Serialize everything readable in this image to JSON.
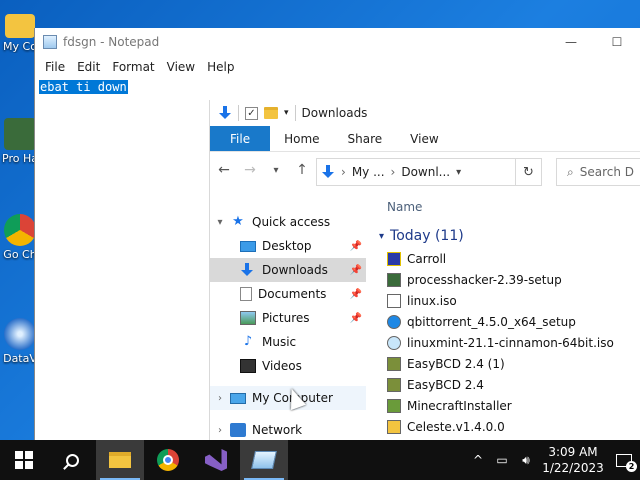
{
  "desktop": {
    "icons": [
      {
        "label": "My Co",
        "icon": "folder-icon"
      },
      {
        "label": "Pro Ha",
        "icon": "process-hacker-icon"
      },
      {
        "label": "Go Ch",
        "icon": "chrome-icon"
      },
      {
        "label": "DataV",
        "icon": "datav-icon"
      }
    ]
  },
  "notepad": {
    "title": "fdsgn - Notepad",
    "menu": [
      "File",
      "Edit",
      "Format",
      "View",
      "Help"
    ],
    "selected_text": "ebat ti down",
    "window_buttons": {
      "minimize": "—",
      "maximize": "☐"
    }
  },
  "explorer": {
    "title": "Downloads",
    "ribbon_tabs": [
      "File",
      "Home",
      "Share",
      "View"
    ],
    "address": {
      "crumb1": "My ...",
      "crumb2": "Downl...",
      "separator": "›"
    },
    "search_placeholder": "Search D",
    "nav": {
      "quick_access": "Quick access",
      "items": [
        {
          "label": "Desktop",
          "pinned": true
        },
        {
          "label": "Downloads",
          "pinned": true,
          "selected": true
        },
        {
          "label": "Documents",
          "pinned": true
        },
        {
          "label": "Pictures",
          "pinned": true
        },
        {
          "label": "Music",
          "pinned": false
        },
        {
          "label": "Videos",
          "pinned": false
        }
      ],
      "my_computer": "My Computer",
      "network": "Network"
    },
    "column_name": "Name",
    "group": {
      "label": "Today (11)"
    },
    "files": [
      "Carroll",
      "processhacker-2.39-setup",
      "linux.iso",
      "qbittorrent_4.5.0_x64_setup",
      "linuxmint-21.1-cinnamon-64bit.iso",
      "EasyBCD 2.4 (1)",
      "EasyBCD 2.4",
      "MinecraftInstaller",
      "Celeste.v1.4.0.0"
    ]
  },
  "taskbar": {
    "clock_time": "3:09 AM",
    "clock_date": "1/22/2023",
    "notification_count": "2",
    "tray_caret": "^"
  }
}
